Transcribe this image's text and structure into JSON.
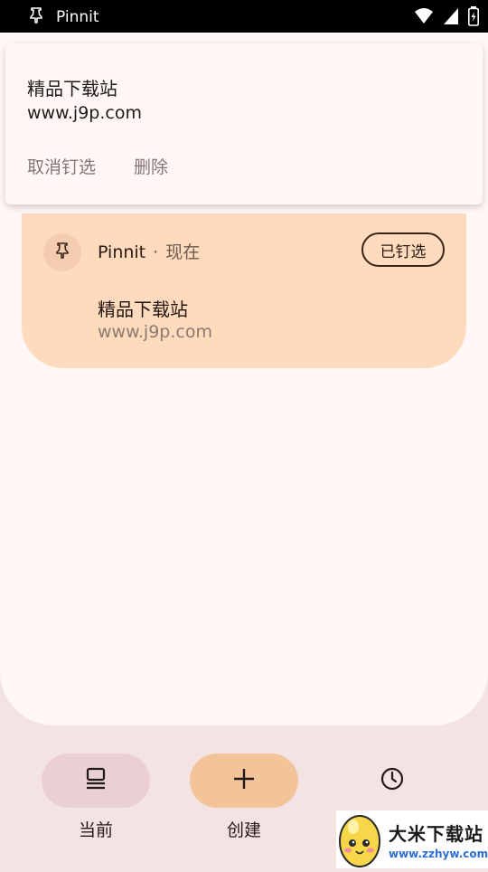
{
  "status_bar": {
    "app_name": "Pinnit",
    "icons": [
      "pin-icon",
      "wifi-icon",
      "signal-icon",
      "battery-icon"
    ]
  },
  "notification": {
    "title": "精品下载站",
    "subtitle": "www.j9p.com",
    "unpin_label": "取消钉选",
    "delete_label": "删除"
  },
  "pin_card": {
    "app_name": "Pinnit",
    "separator": "·",
    "time": "现在",
    "chip_label": "已钉选",
    "title": "精品下载站",
    "subtitle": "www.j9p.com"
  },
  "nav": {
    "current_label": "当前",
    "create_label": "创建",
    "history_label": ""
  },
  "watermark": {
    "name": "大米下载站",
    "url": "www.zzhyw.com"
  },
  "colors": {
    "card": "#ffdbbd",
    "sheet": "#fff8f7",
    "background": "#f3e3e3",
    "nav_current_pill": "#ead0d3",
    "nav_create_pill": "#f3c39a"
  }
}
